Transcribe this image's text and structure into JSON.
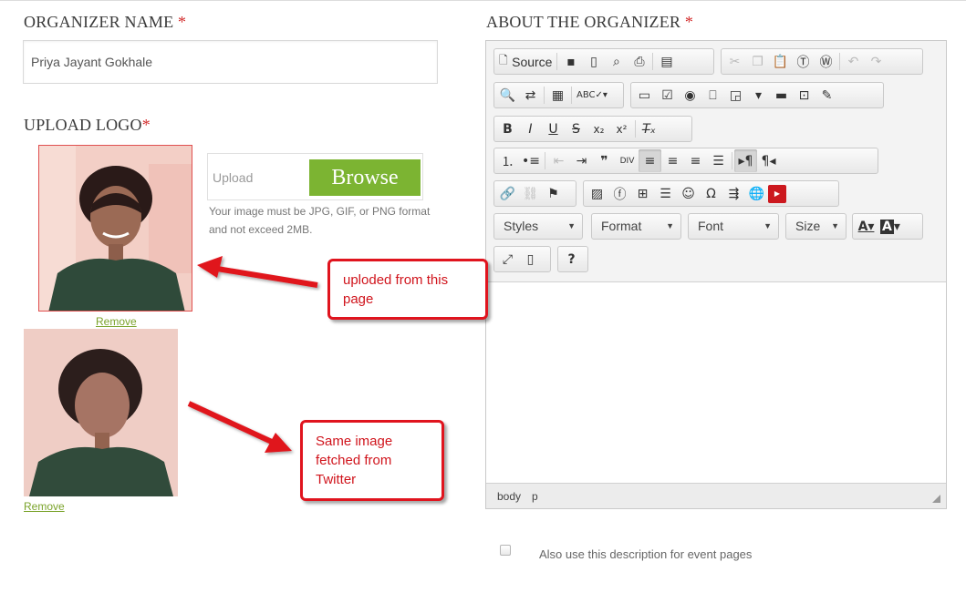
{
  "organizer_name": {
    "label": "ORGANIZER NAME",
    "required_mark": "*",
    "value": "Priya Jayant Gokhale"
  },
  "upload_logo": {
    "label": "UPLOAD LOGO",
    "required_mark": "*",
    "upload_placeholder": "Upload",
    "browse_label": "Browse",
    "help_text": "Your image must be JPG, GIF, or PNG format and not exceed 2MB.",
    "remove_label_1": "Remove",
    "remove_label_2": "Remove"
  },
  "about": {
    "label": "ABOUT THE ORGANIZER",
    "required_mark": "*"
  },
  "editor": {
    "source_label": "Source",
    "combos": {
      "styles": "Styles",
      "format": "Format",
      "font": "Font",
      "size": "Size"
    },
    "status_path": [
      "body",
      "p"
    ]
  },
  "description_option": {
    "label": "Also use this description for event pages",
    "checked": false
  },
  "annotations": {
    "callout_1": "uploded from this page",
    "callout_2": "Same image fetched from Twitter"
  },
  "colors": {
    "accent_green": "#7cb432",
    "required_red": "#d32f2f",
    "annotation_red": "#e0141e"
  }
}
